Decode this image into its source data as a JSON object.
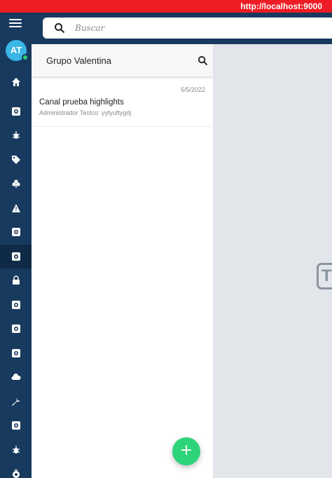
{
  "browser": {
    "url": "http://localhost:9000"
  },
  "sidebar": {
    "avatar_initials": "AT",
    "items": [
      {
        "icon": "home-icon"
      },
      {
        "icon": "app-icon"
      },
      {
        "icon": "bug-icon"
      },
      {
        "icon": "tag-icon"
      },
      {
        "icon": "club-icon"
      },
      {
        "icon": "warning-icon"
      },
      {
        "icon": "app-icon"
      },
      {
        "icon": "app-icon",
        "active": true
      },
      {
        "icon": "lock-icon"
      },
      {
        "icon": "app-icon"
      },
      {
        "icon": "app-icon"
      },
      {
        "icon": "app-icon"
      },
      {
        "icon": "cloud-icon"
      },
      {
        "icon": "wrench-icon"
      },
      {
        "icon": "app-icon"
      },
      {
        "icon": "bug-icon"
      },
      {
        "icon": "timer-icon"
      }
    ]
  },
  "search": {
    "placeholder": "Buscar"
  },
  "panel": {
    "title": "Grupo Valentina",
    "channels": [
      {
        "date": "5/5/2022",
        "name": "Canal prueba highlights",
        "subtitle": "Administrador Testco: yytyuftygdj"
      }
    ]
  },
  "fab": {
    "label": "+"
  },
  "content": {
    "logo_letter": "T"
  },
  "colors": {
    "sidebar": "#173a5e",
    "url_bar": "#ee1c24",
    "fab": "#2ed47a",
    "avatar": "#39b6e6"
  }
}
